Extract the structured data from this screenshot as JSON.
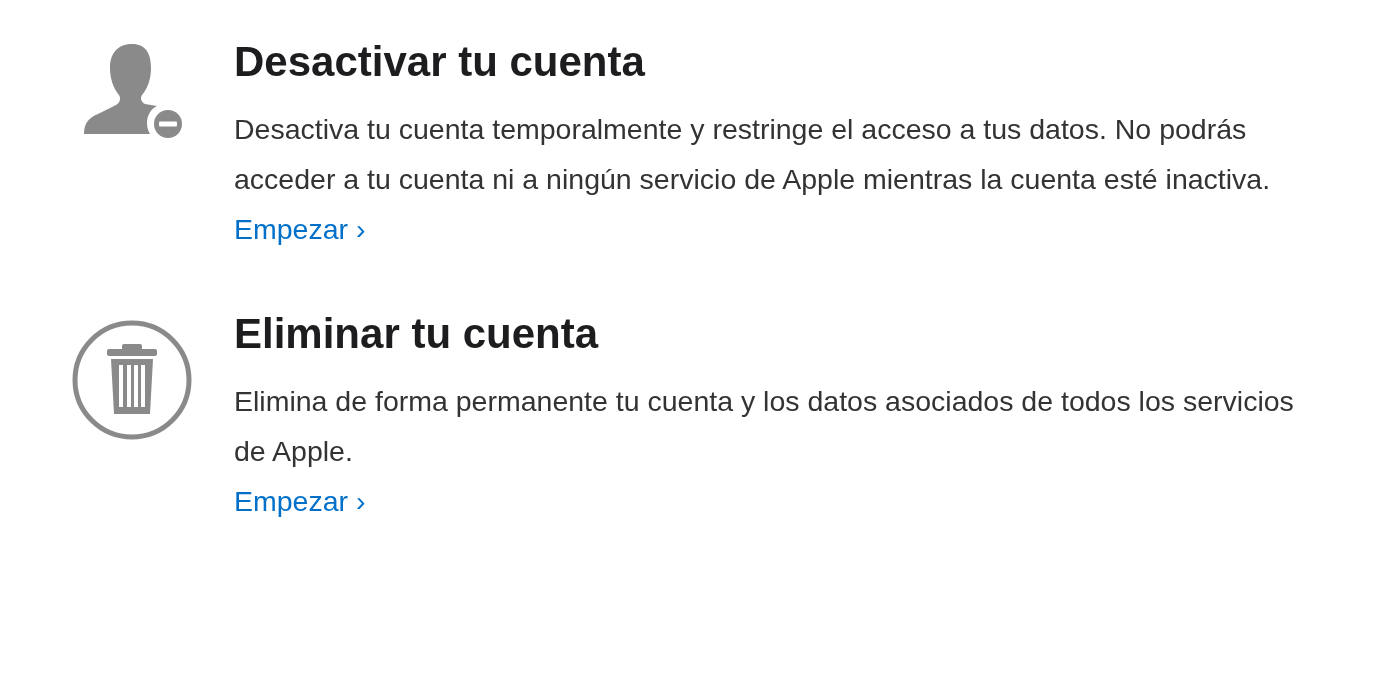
{
  "sections": [
    {
      "kind": "deactivate",
      "title": "Desactivar tu cuenta",
      "description": "Desactiva tu cuenta temporalmente y restringe el acceso a tus datos. No podrás acceder a tu cuenta ni a ningún servicio de Apple mientras la cuenta esté inactiva.",
      "link": "Empezar ›"
    },
    {
      "kind": "delete",
      "title": "Eliminar tu cuenta",
      "description": "Elimina de forma permanente tu cuenta y los datos asociados de todos los servicios de Apple.",
      "link": "Empezar ›"
    }
  ]
}
